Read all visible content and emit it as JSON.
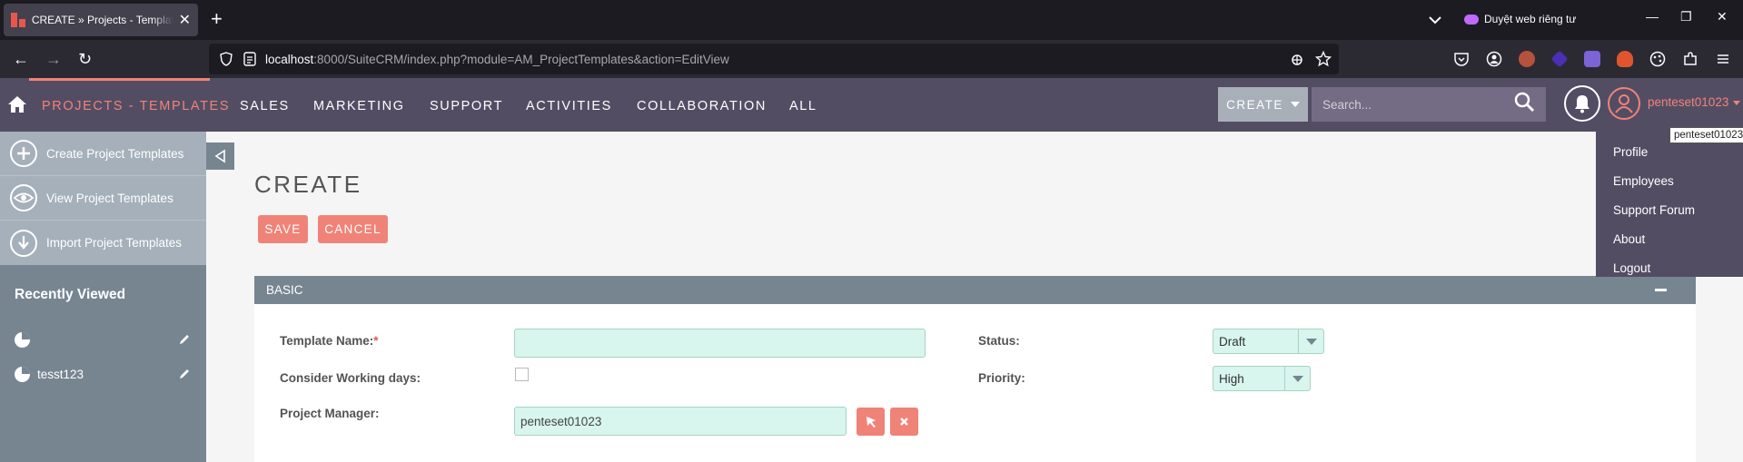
{
  "browser": {
    "tab_title": "CREATE » Projects - Templates » SuiteCRM",
    "new_tab_label": "+",
    "private_label": "Duyệt web riêng tư",
    "url_host": "localhost",
    "url_rest": ":8000/SuiteCRM/index.php?module=AM_ProjectTemplates&action=EditView"
  },
  "nav": {
    "active_module": "PROJECTS - TEMPLATES",
    "modules": [
      "SALES",
      "MARKETING",
      "SUPPORT",
      "ACTIVITIES",
      "COLLABORATION",
      "ALL"
    ],
    "create_label": "CREATE",
    "search_placeholder": "Search...",
    "username": "penteset01023"
  },
  "sidebar": {
    "actions": [
      {
        "label": "Create Project Templates",
        "icon": "plus-icon"
      },
      {
        "label": "View Project Templates",
        "icon": "eye-icon"
      },
      {
        "label": "Import Project Templates",
        "icon": "import-icon"
      }
    ],
    "recent_title": "Recently Viewed",
    "recent_items": [
      {
        "label": ""
      },
      {
        "label": "tesst123"
      }
    ]
  },
  "main": {
    "title": "CREATE",
    "save_label": "SAVE",
    "cancel_label": "CANCEL",
    "panel_title": "BASIC",
    "fields": {
      "template_name_label": "Template Name:",
      "required_mark": "*",
      "template_name_value": "",
      "working_days_label": "Consider Working days:",
      "working_days_checked": false,
      "project_manager_label": "Project Manager:",
      "project_manager_value": "penteset01023",
      "status_label": "Status:",
      "status_value": "Draft",
      "priority_label": "Priority:",
      "priority_value": "High"
    }
  },
  "user_menu": {
    "items": [
      "Profile",
      "Employees",
      "Support Forum",
      "About",
      "Logout"
    ],
    "tooltip": "penteset01023"
  },
  "colors": {
    "accent": "#f08377",
    "nav_bg": "#534d64",
    "sidebar_bg": "#778591",
    "field_bg": "#d8f5ee"
  }
}
